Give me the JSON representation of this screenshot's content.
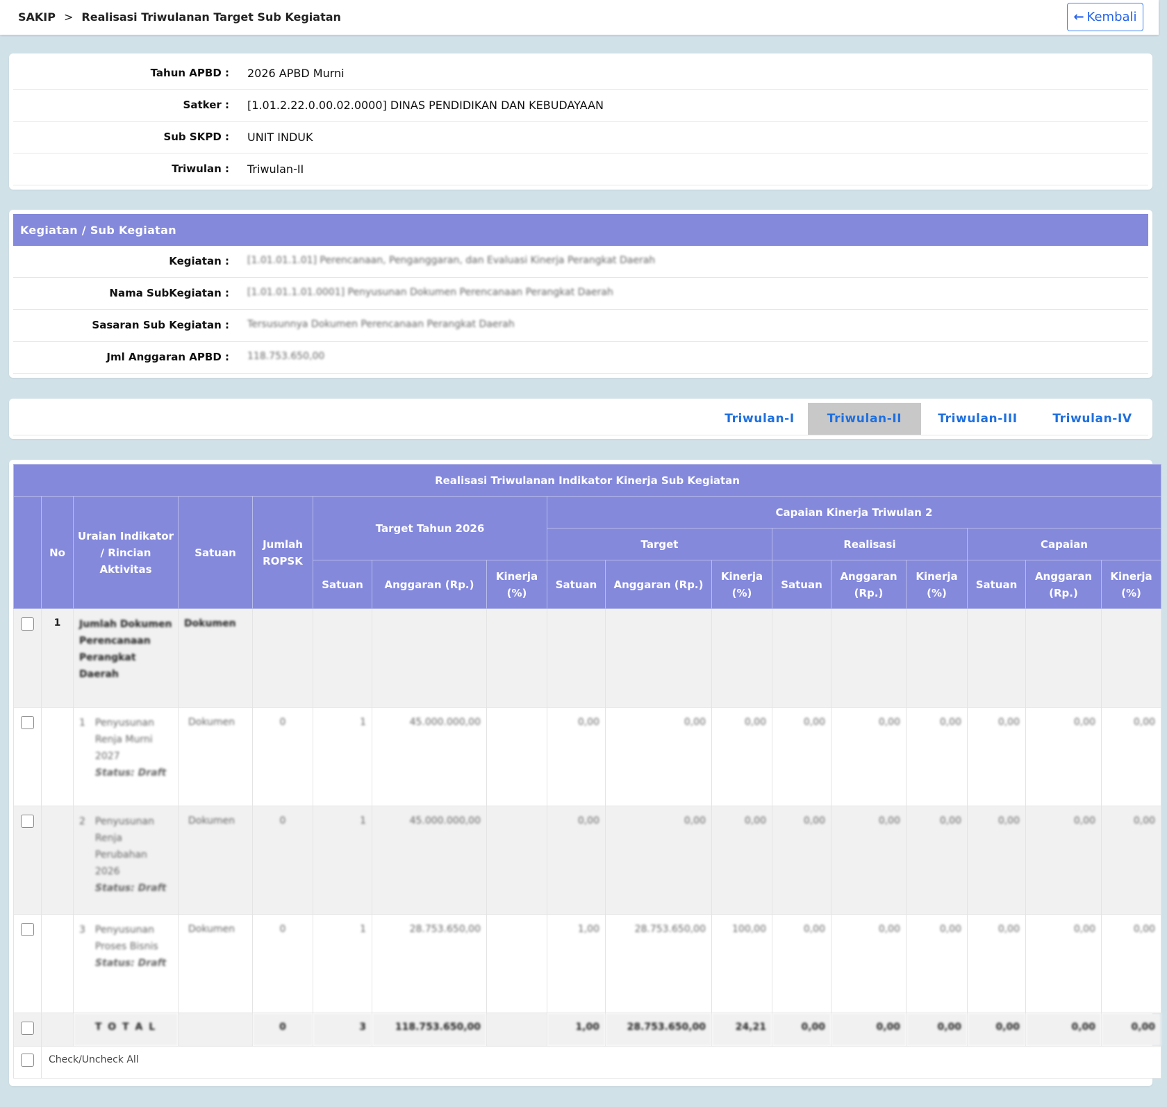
{
  "header": {
    "breadcrumb_root": "SAKIP",
    "breadcrumb_sep": ">",
    "breadcrumb_page": "Realisasi Triwulanan Target Sub Kegiatan",
    "back_label": "Kembali"
  },
  "info": {
    "tahun_label": "Tahun APBD :",
    "tahun_value": "2026 APBD Murni",
    "satker_label": "Satker :",
    "satker_value": "[1.01.2.22.0.00.02.0000] DINAS PENDIDIKAN DAN KEBUDAYAAN",
    "subskpd_label": "Sub SKPD :",
    "subskpd_value": "UNIT INDUK",
    "triwulan_label": "Triwulan :",
    "triwulan_value": "Triwulan-II"
  },
  "kegiatan": {
    "section_title": "Kegiatan / Sub Kegiatan",
    "kegiatan_label": "Kegiatan :",
    "kegiatan_value": "[1.01.01.1.01] Perencanaan, Penganggaran, dan Evaluasi Kinerja Perangkat Daerah",
    "subkeg_label": "Nama SubKegiatan :",
    "subkeg_value": "[1.01.01.1.01.0001] Penyusunan Dokumen Perencanaan Perangkat Daerah",
    "sasaran_label": "Sasaran Sub Kegiatan :",
    "sasaran_value": "Tersusunnya Dokumen Perencanaan Perangkat Daerah",
    "anggaran_label": "Jml Anggaran APBD :",
    "anggaran_value": "118.753.650,00"
  },
  "tabs": [
    "Triwulan-I",
    "Triwulan-II",
    "Triwulan-III",
    "Triwulan-IV"
  ],
  "active_tab": "Triwulan-II",
  "table": {
    "title": "Realisasi Triwulanan Indikator Kinerja Sub Kegiatan",
    "h_no": "No",
    "h_uraian": "Uraian Indikator / Rincian Aktivitas",
    "h_satuan": "Satuan",
    "h_jumlah": "Jumlah ROPSK",
    "h_target_tahun": "Target Tahun 2026",
    "h_capaian_tw": "Capaian Kinerja Triwulan 2",
    "h_target": "Target",
    "h_realisasi": "Realisasi",
    "h_capaian": "Capaian",
    "h_sub_satuan": "Satuan",
    "h_sub_anggaran": "Anggaran (Rp.)",
    "h_sub_kinerja": "Kinerja (%)",
    "indicator": {
      "no": "1",
      "uraian": "Jumlah Dokumen Perencanaan Perangkat Daerah",
      "satuan": "Dokumen"
    },
    "rows": [
      {
        "no": "1",
        "uraian": "Penyusunan Renja Murni 2027",
        "status": "Status: Draft",
        "satuan": "Dokumen",
        "jumlah": "0",
        "t_satuan": "1",
        "t_anggaran": "45.000.000,00",
        "t_kinerja": "",
        "tg_satuan": "0,00",
        "tg_anggaran": "0,00",
        "tg_kinerja": "0,00",
        "r_satuan": "0,00",
        "r_anggaran": "0,00",
        "r_kinerja": "0,00",
        "c_satuan": "0,00",
        "c_anggaran": "0,00",
        "c_kinerja": "0,00"
      },
      {
        "no": "2",
        "uraian": "Penyusunan Renja Perubahan 2026",
        "status": "Status: Draft",
        "satuan": "Dokumen",
        "jumlah": "0",
        "t_satuan": "1",
        "t_anggaran": "45.000.000,00",
        "t_kinerja": "",
        "tg_satuan": "0,00",
        "tg_anggaran": "0,00",
        "tg_kinerja": "0,00",
        "r_satuan": "0,00",
        "r_anggaran": "0,00",
        "r_kinerja": "0,00",
        "c_satuan": "0,00",
        "c_anggaran": "0,00",
        "c_kinerja": "0,00"
      },
      {
        "no": "3",
        "uraian": "Penyusunan Proses Bisnis",
        "status": "Status: Draft",
        "satuan": "Dokumen",
        "jumlah": "0",
        "t_satuan": "1",
        "t_anggaran": "28.753.650,00",
        "t_kinerja": "",
        "tg_satuan": "1,00",
        "tg_anggaran": "28.753.650,00",
        "tg_kinerja": "100,00",
        "r_satuan": "0,00",
        "r_anggaran": "0,00",
        "r_kinerja": "0,00",
        "c_satuan": "0,00",
        "c_anggaran": "0,00",
        "c_kinerja": "0,00"
      }
    ],
    "total": {
      "label": "T O T A L",
      "jumlah": "0",
      "t_satuan": "3",
      "t_anggaran": "118.753.650,00",
      "tg_satuan": "1,00",
      "tg_anggaran": "28.753.650,00",
      "tg_kinerja": "24,21",
      "r_satuan": "0,00",
      "r_anggaran": "0,00",
      "r_kinerja": "0,00",
      "c_satuan": "0,00",
      "c_anggaran": "0,00",
      "c_kinerja": "0,00"
    },
    "check_all_label": "Check/Uncheck All"
  },
  "colors": {
    "header_purple": "#8489dc",
    "page_bg": "#d1e1e8",
    "link_blue": "#3b6fe0",
    "status_red": "#e23a3a",
    "tab_active_bg": "#c8c8c8"
  }
}
